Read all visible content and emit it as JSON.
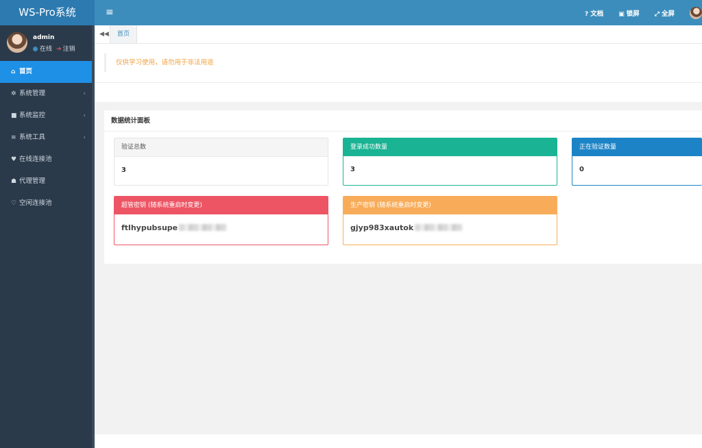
{
  "app": {
    "title": "WS-Pro系统"
  },
  "user": {
    "name": "admin",
    "status": "在线",
    "logout": "注销"
  },
  "sidebar": {
    "items": [
      {
        "label": "首页",
        "icon": "home-icon",
        "glyph": "⌂",
        "active": true,
        "submenu": false
      },
      {
        "label": "系统管理",
        "icon": "gear-icon",
        "glyph": "✲",
        "active": false,
        "submenu": true
      },
      {
        "label": "系统监控",
        "icon": "video-icon",
        "glyph": "■",
        "active": false,
        "submenu": true
      },
      {
        "label": "系统工具",
        "icon": "list-icon",
        "glyph": "≡",
        "active": false,
        "submenu": true
      },
      {
        "label": "在线连接池",
        "icon": "heartbeat-icon",
        "glyph": "♥",
        "active": false,
        "submenu": false
      },
      {
        "label": "代理管理",
        "icon": "users-icon",
        "glyph": "☗",
        "active": false,
        "submenu": false
      },
      {
        "label": "空闲连接池",
        "icon": "heart-outline-icon",
        "glyph": "♡",
        "active": false,
        "submenu": false
      }
    ]
  },
  "topbar": {
    "actions": [
      {
        "label": "文档",
        "icon": "question-icon",
        "glyph": "❓"
      },
      {
        "label": "锁屏",
        "icon": "lock-icon",
        "glyph": "🔒"
      },
      {
        "label": "全屏",
        "icon": "expand-icon",
        "glyph": "⤢"
      }
    ]
  },
  "tabs": {
    "home": "首页"
  },
  "notice": "仅供学习使用，请勿用于非法用途",
  "panel": {
    "title": "数据统计面板",
    "cards": [
      {
        "header": "验证总数",
        "value": "3"
      },
      {
        "header": "登录成功数量",
        "value": "3"
      },
      {
        "header": "正在验证数量",
        "value": "0"
      },
      {
        "header": "超管密钥 (随系统重启时变更)",
        "value": "ftlhypubsupe"
      },
      {
        "header": "生产密钥 (随系统重启时变更)",
        "value": "gjyp983xautok"
      }
    ]
  },
  "colors": {
    "sidebar": "#2b3a4a",
    "topbar": "#3c8dbc",
    "active": "#1e90e6",
    "green": "#1ab394",
    "blue": "#1c84c6",
    "red": "#ed5565",
    "orange": "#f8ac59",
    "notice": "#f0a03c"
  }
}
